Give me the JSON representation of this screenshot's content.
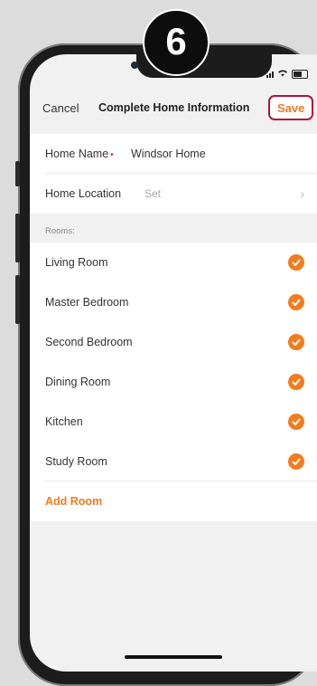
{
  "step": "6",
  "status": {
    "signal": "signal-icon",
    "wifi": "wifi-icon",
    "battery": "battery-icon"
  },
  "nav": {
    "cancel": "Cancel",
    "title": "Complete Home Information",
    "save": "Save"
  },
  "home": {
    "name_label": "Home Name",
    "name_value": "Windsor Home",
    "location_label": "Home Location",
    "location_value": "Set"
  },
  "rooms_header": "Rooms:",
  "rooms": [
    {
      "label": "Living Room",
      "checked": true
    },
    {
      "label": "Master Bedroom",
      "checked": true
    },
    {
      "label": "Second Bedroom",
      "checked": true
    },
    {
      "label": "Dining Room",
      "checked": true
    },
    {
      "label": "Kitchen",
      "checked": true
    },
    {
      "label": "Study Room",
      "checked": true
    }
  ],
  "add_room": "Add Room",
  "colors": {
    "accent": "#f27c1e",
    "highlight": "#b0123a"
  }
}
